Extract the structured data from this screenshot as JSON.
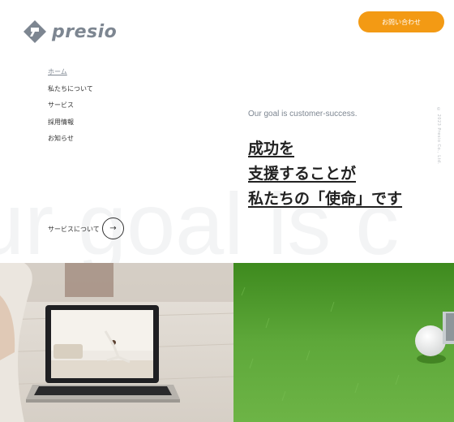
{
  "header": {
    "logo_text": "presio",
    "contact_label": "お問い合わせ"
  },
  "nav": {
    "items": [
      {
        "label": "ホーム",
        "active": true
      },
      {
        "label": "私たちについて",
        "active": false
      },
      {
        "label": "サービス",
        "active": false
      },
      {
        "label": "採用情報",
        "active": false
      },
      {
        "label": "お知らせ",
        "active": false
      }
    ]
  },
  "hero": {
    "goal": "Our goal is customer-success.",
    "headline": [
      "成功を",
      "支援することが",
      "私たちの「使命」です"
    ],
    "background_text": "ur goal is c",
    "copyright": "© 2023 Presio Co., Ltd."
  },
  "services_link": {
    "label": "サービスについて",
    "arrow_icon": "arrow-right-icon"
  },
  "colors": {
    "accent": "#f39a14",
    "logo": "#7d8691",
    "grass": "#4c9a2a"
  }
}
